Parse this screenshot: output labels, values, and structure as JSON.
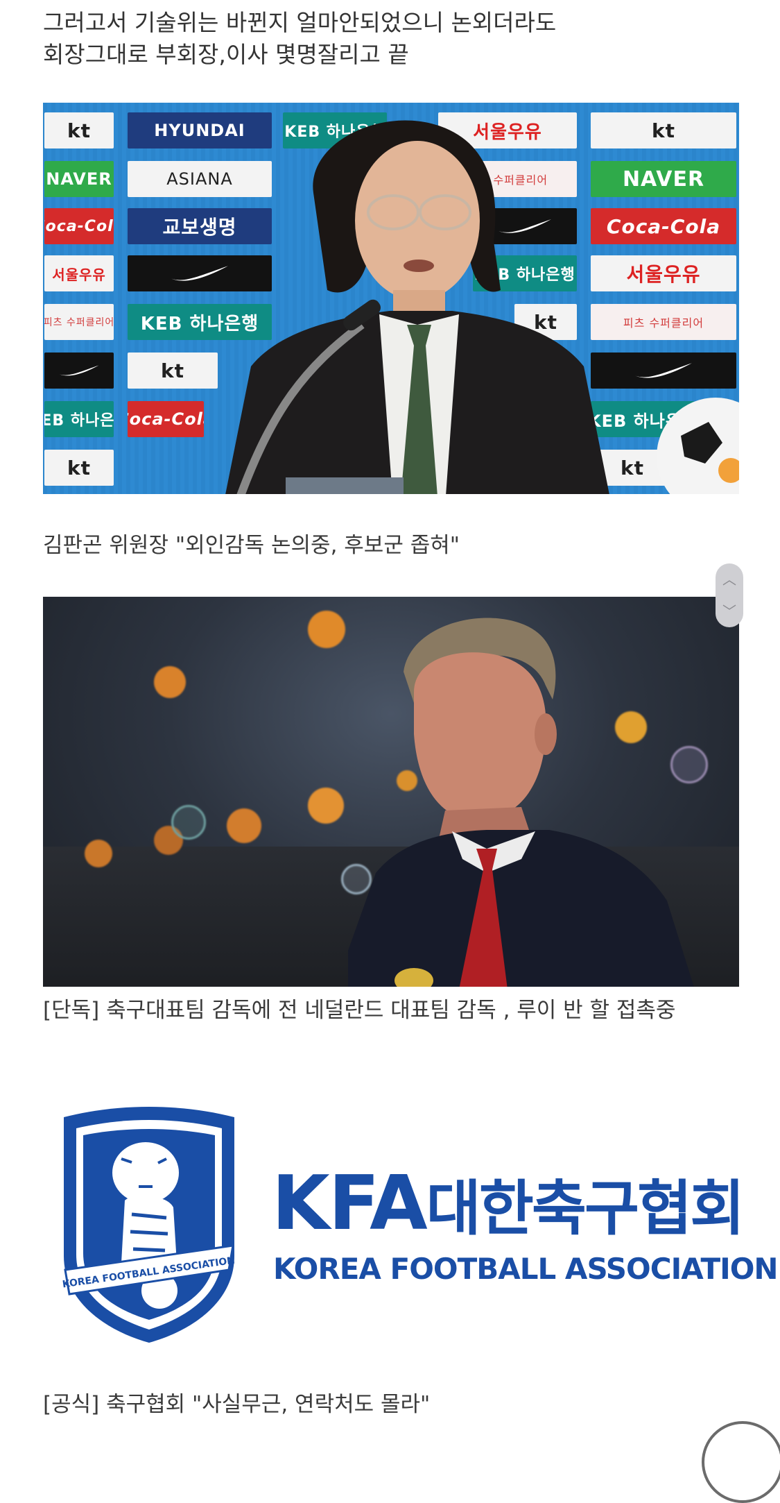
{
  "post": {
    "intro_line_1": "그러고서 기술위는 바뀐지 얼마안되었으니 논외더라도",
    "intro_line_2": "회장그대로 부회장,이사 몇명잘리고 끝",
    "caption_1": "김판곤 위원장 \"외인감독 논의중, 후보군 좁혀\"",
    "caption_2": "[단독] 축구대표팀 감독에 전 네덜란드 대표팀 감독 , 루이 반 할  접촉중",
    "caption_3": "[공식] 축구협회 \"사실무근, 연락처도 몰라\""
  },
  "sponsors": {
    "kt": "kt",
    "hyundai": "HYUNDAI",
    "keb": "KEB 하나은행",
    "seoul_milk": "서울우유",
    "naver": "NAVER",
    "asiana": "ASIANA",
    "kyobo": "교보생명",
    "coca_cola": "Coca-Cola",
    "fitz": "피츠 수퍼클리어"
  },
  "logo": {
    "kfa": "KFA",
    "korean_name": "대한축구협회",
    "english_name": "KOREA FOOTBALL ASSOCIATION",
    "badge_text": "KOREA FOOTBALL ASSOCIATION"
  },
  "colors": {
    "kfa_blue": "#1a4ea6",
    "board_blue": "#2b85cc"
  },
  "controls": {
    "scroll_up_icon": "chevron-up-icon",
    "scroll_down_icon": "chevron-down-icon",
    "scroll_up_glyph": "︿",
    "scroll_down_glyph": "﹀"
  }
}
